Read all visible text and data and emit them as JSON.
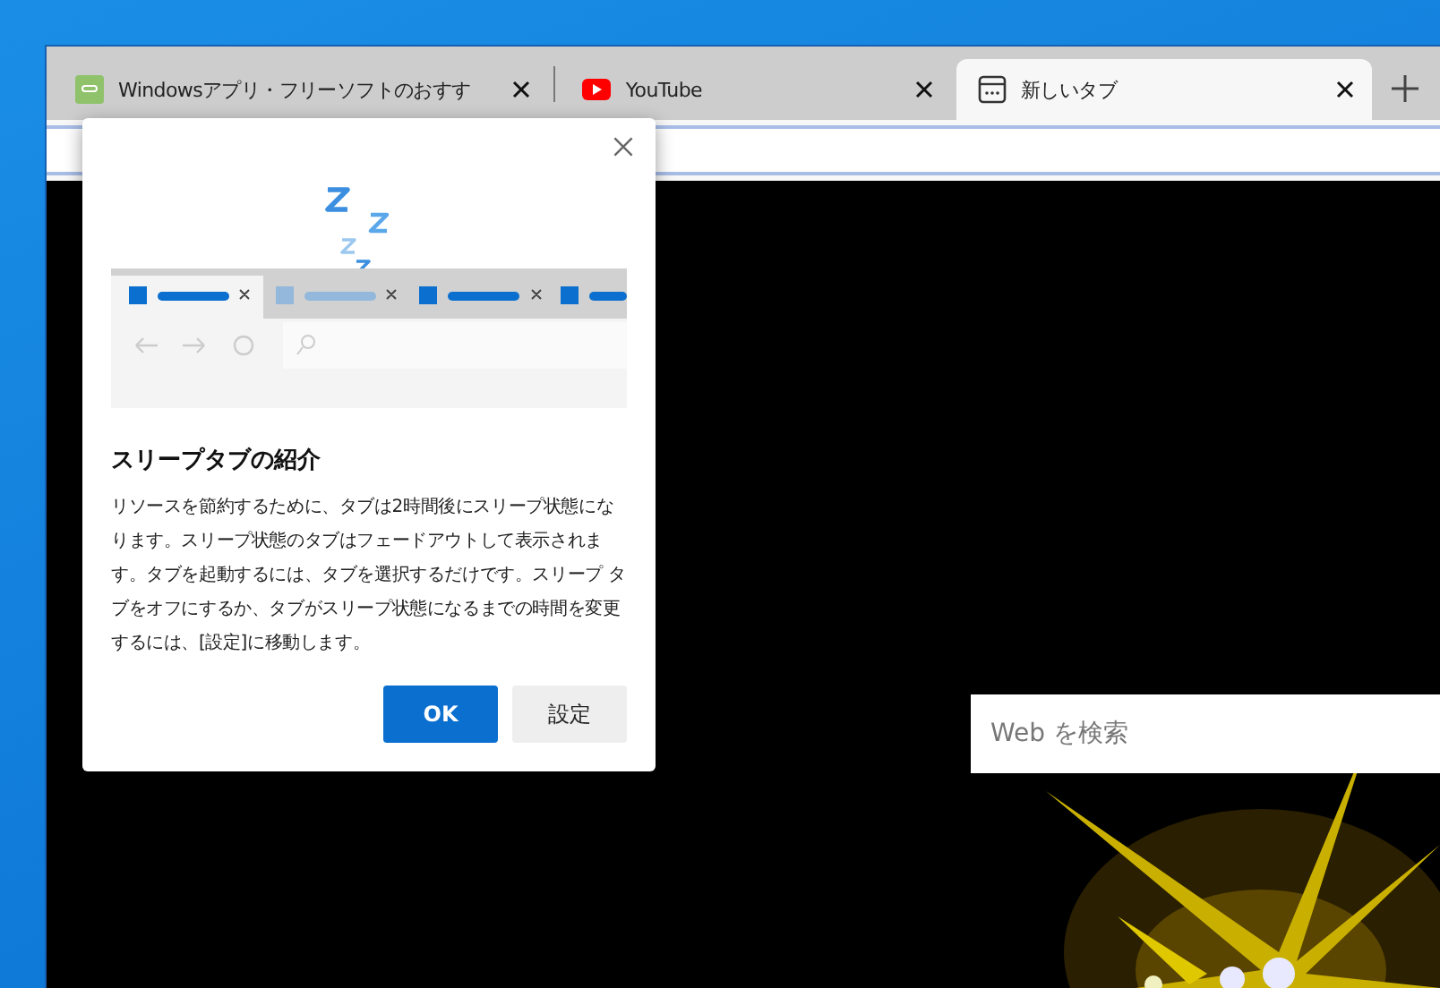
{
  "tabs": [
    {
      "kind": "site",
      "title": "Windowsアプリ・フリーソフトのおすす",
      "selected": false
    },
    {
      "kind": "video",
      "title": "YouTube",
      "selected": false
    },
    {
      "kind": "newtab",
      "title": "新しいタブ",
      "selected": true
    }
  ],
  "dialog": {
    "title": "スリープタブの紹介",
    "body": "リソースを節約するために、タブは2時間後にスリープ状態になります。スリープ状態のタブはフェードアウトして表示されます。タブを起動するには、タブを選択するだけです。スリープ タブをオフにするか、タブがスリープ状態になるまでの時間を変更するには、[設定]に移動します。",
    "buttons": [
      {
        "label": "OK",
        "primary": true
      },
      {
        "label": "設定",
        "primary": false
      }
    ]
  },
  "search": {
    "placeholder": "Web を検索"
  }
}
